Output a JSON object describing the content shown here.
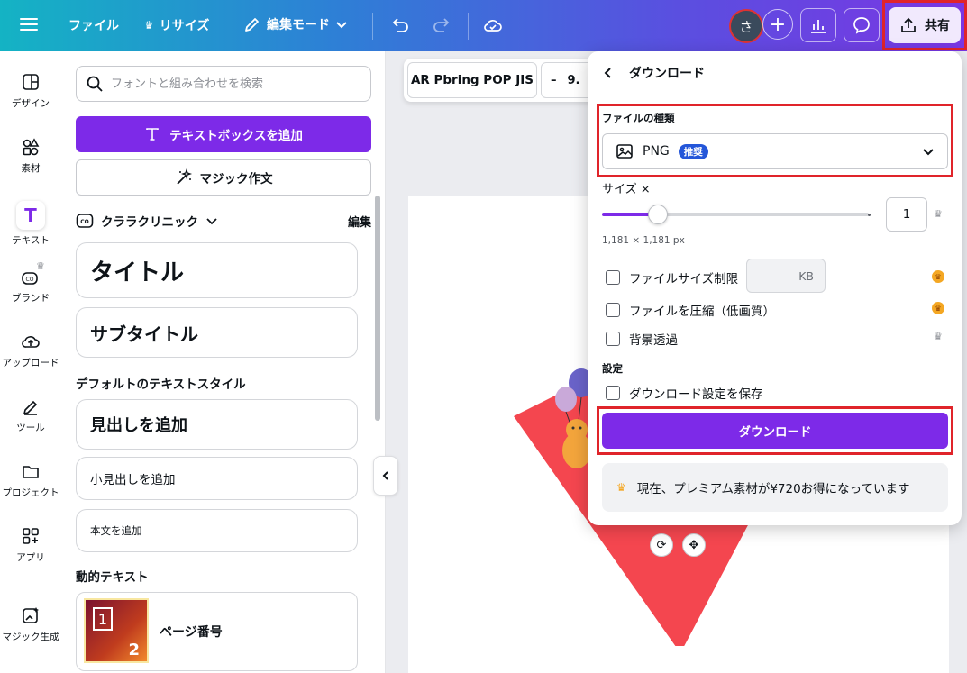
{
  "topbar": {
    "file_label": "ファイル",
    "resize_label": "リサイズ",
    "edit_mode_label": "編集モード",
    "avatar_initial": "さ",
    "share_label": "共有"
  },
  "rail": {
    "items": [
      {
        "label": "デザイン",
        "icon": "layout-icon"
      },
      {
        "label": "素材",
        "icon": "elements-icon"
      },
      {
        "label": "テキスト",
        "icon": "text-icon"
      },
      {
        "label": "ブランド",
        "icon": "brand-icon"
      },
      {
        "label": "アップロード",
        "icon": "upload-icon"
      },
      {
        "label": "ツール",
        "icon": "tool-icon"
      },
      {
        "label": "プロジェクト",
        "icon": "folder-icon"
      },
      {
        "label": "アプリ",
        "icon": "apps-icon"
      },
      {
        "label": "マジック生成",
        "icon": "magic-media-icon"
      }
    ]
  },
  "panel": {
    "search_placeholder": "フォントと組み合わせを検索",
    "add_textbox_label": "テキストボックスを追加",
    "magic_write_label": "マジック作文",
    "brand_name": "クララクリニック",
    "brand_edit": "編集",
    "brand_title": "タイトル",
    "brand_subtitle": "サブタイトル",
    "default_styles_heading": "デフォルトのテキストスタイル",
    "heading_label": "見出しを追加",
    "subheading_label": "小見出しを追加",
    "body_label": "本文を追加",
    "dynamic_heading": "動的テキスト",
    "page_number_label": "ページ番号",
    "page_number_thumb_one": "1",
    "page_number_thumb_two": "2"
  },
  "editor": {
    "font_name": "AR Pbring POP JIS",
    "font_size_minus": "–",
    "font_size_value": "9."
  },
  "download": {
    "title": "ダウンロード",
    "file_type_label": "ファイルの種類",
    "file_type_value": "PNG",
    "recommended_badge": "推奨",
    "size_label": "サイズ ×",
    "size_value": "1",
    "slider_fraction": 0.21,
    "pixel_info": "1,181 × 1,181 px",
    "limit_file_size": "ファイルサイズ制限",
    "kb_unit": "KB",
    "compress_file": "ファイルを圧縮（低画質）",
    "transparent_bg": "背景透過",
    "settings_label": "設定",
    "save_settings": "ダウンロード設定を保存",
    "download_button": "ダウンロード",
    "promo_text": "現在、プレミアム素材が¥720お得になっています"
  },
  "colors": {
    "accent_purple": "#7d2ae8",
    "highlight_red": "#e0242a",
    "badge_blue": "#2456d9",
    "diamond_red": "#f4464f"
  }
}
